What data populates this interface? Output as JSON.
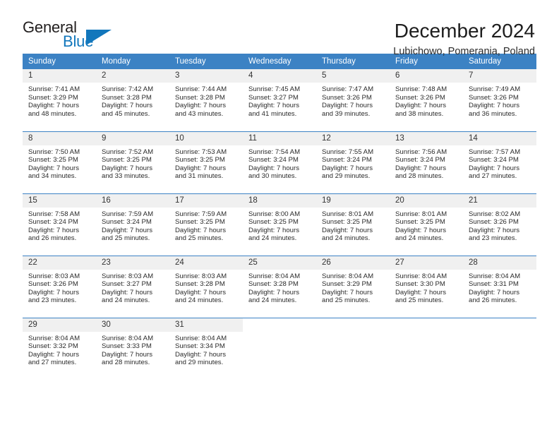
{
  "brand": {
    "name_part1": "General",
    "name_part2": "Blue",
    "logo_icon": "triangle-flag-icon",
    "accent_color": "#1277bc"
  },
  "header": {
    "title": "December 2024",
    "location": "Lubichowo, Pomerania, Poland"
  },
  "theme": {
    "header_row_bg": "#3c82c4",
    "daynum_bg": "#f0f0f0",
    "week_divider": "#3c82c4",
    "text": "#2b2b2b"
  },
  "calendar": {
    "weekday_headers": [
      "Sunday",
      "Monday",
      "Tuesday",
      "Wednesday",
      "Thursday",
      "Friday",
      "Saturday"
    ],
    "weeks": [
      [
        {
          "day": "1",
          "sunrise": "Sunrise: 7:41 AM",
          "sunset": "Sunset: 3:29 PM",
          "daylight_line1": "Daylight: 7 hours",
          "daylight_line2": "and 48 minutes."
        },
        {
          "day": "2",
          "sunrise": "Sunrise: 7:42 AM",
          "sunset": "Sunset: 3:28 PM",
          "daylight_line1": "Daylight: 7 hours",
          "daylight_line2": "and 45 minutes."
        },
        {
          "day": "3",
          "sunrise": "Sunrise: 7:44 AM",
          "sunset": "Sunset: 3:28 PM",
          "daylight_line1": "Daylight: 7 hours",
          "daylight_line2": "and 43 minutes."
        },
        {
          "day": "4",
          "sunrise": "Sunrise: 7:45 AM",
          "sunset": "Sunset: 3:27 PM",
          "daylight_line1": "Daylight: 7 hours",
          "daylight_line2": "and 41 minutes."
        },
        {
          "day": "5",
          "sunrise": "Sunrise: 7:47 AM",
          "sunset": "Sunset: 3:26 PM",
          "daylight_line1": "Daylight: 7 hours",
          "daylight_line2": "and 39 minutes."
        },
        {
          "day": "6",
          "sunrise": "Sunrise: 7:48 AM",
          "sunset": "Sunset: 3:26 PM",
          "daylight_line1": "Daylight: 7 hours",
          "daylight_line2": "and 38 minutes."
        },
        {
          "day": "7",
          "sunrise": "Sunrise: 7:49 AM",
          "sunset": "Sunset: 3:26 PM",
          "daylight_line1": "Daylight: 7 hours",
          "daylight_line2": "and 36 minutes."
        }
      ],
      [
        {
          "day": "8",
          "sunrise": "Sunrise: 7:50 AM",
          "sunset": "Sunset: 3:25 PM",
          "daylight_line1": "Daylight: 7 hours",
          "daylight_line2": "and 34 minutes."
        },
        {
          "day": "9",
          "sunrise": "Sunrise: 7:52 AM",
          "sunset": "Sunset: 3:25 PM",
          "daylight_line1": "Daylight: 7 hours",
          "daylight_line2": "and 33 minutes."
        },
        {
          "day": "10",
          "sunrise": "Sunrise: 7:53 AM",
          "sunset": "Sunset: 3:25 PM",
          "daylight_line1": "Daylight: 7 hours",
          "daylight_line2": "and 31 minutes."
        },
        {
          "day": "11",
          "sunrise": "Sunrise: 7:54 AM",
          "sunset": "Sunset: 3:24 PM",
          "daylight_line1": "Daylight: 7 hours",
          "daylight_line2": "and 30 minutes."
        },
        {
          "day": "12",
          "sunrise": "Sunrise: 7:55 AM",
          "sunset": "Sunset: 3:24 PM",
          "daylight_line1": "Daylight: 7 hours",
          "daylight_line2": "and 29 minutes."
        },
        {
          "day": "13",
          "sunrise": "Sunrise: 7:56 AM",
          "sunset": "Sunset: 3:24 PM",
          "daylight_line1": "Daylight: 7 hours",
          "daylight_line2": "and 28 minutes."
        },
        {
          "day": "14",
          "sunrise": "Sunrise: 7:57 AM",
          "sunset": "Sunset: 3:24 PM",
          "daylight_line1": "Daylight: 7 hours",
          "daylight_line2": "and 27 minutes."
        }
      ],
      [
        {
          "day": "15",
          "sunrise": "Sunrise: 7:58 AM",
          "sunset": "Sunset: 3:24 PM",
          "daylight_line1": "Daylight: 7 hours",
          "daylight_line2": "and 26 minutes."
        },
        {
          "day": "16",
          "sunrise": "Sunrise: 7:59 AM",
          "sunset": "Sunset: 3:24 PM",
          "daylight_line1": "Daylight: 7 hours",
          "daylight_line2": "and 25 minutes."
        },
        {
          "day": "17",
          "sunrise": "Sunrise: 7:59 AM",
          "sunset": "Sunset: 3:25 PM",
          "daylight_line1": "Daylight: 7 hours",
          "daylight_line2": "and 25 minutes."
        },
        {
          "day": "18",
          "sunrise": "Sunrise: 8:00 AM",
          "sunset": "Sunset: 3:25 PM",
          "daylight_line1": "Daylight: 7 hours",
          "daylight_line2": "and 24 minutes."
        },
        {
          "day": "19",
          "sunrise": "Sunrise: 8:01 AM",
          "sunset": "Sunset: 3:25 PM",
          "daylight_line1": "Daylight: 7 hours",
          "daylight_line2": "and 24 minutes."
        },
        {
          "day": "20",
          "sunrise": "Sunrise: 8:01 AM",
          "sunset": "Sunset: 3:25 PM",
          "daylight_line1": "Daylight: 7 hours",
          "daylight_line2": "and 24 minutes."
        },
        {
          "day": "21",
          "sunrise": "Sunrise: 8:02 AM",
          "sunset": "Sunset: 3:26 PM",
          "daylight_line1": "Daylight: 7 hours",
          "daylight_line2": "and 23 minutes."
        }
      ],
      [
        {
          "day": "22",
          "sunrise": "Sunrise: 8:03 AM",
          "sunset": "Sunset: 3:26 PM",
          "daylight_line1": "Daylight: 7 hours",
          "daylight_line2": "and 23 minutes."
        },
        {
          "day": "23",
          "sunrise": "Sunrise: 8:03 AM",
          "sunset": "Sunset: 3:27 PM",
          "daylight_line1": "Daylight: 7 hours",
          "daylight_line2": "and 24 minutes."
        },
        {
          "day": "24",
          "sunrise": "Sunrise: 8:03 AM",
          "sunset": "Sunset: 3:28 PM",
          "daylight_line1": "Daylight: 7 hours",
          "daylight_line2": "and 24 minutes."
        },
        {
          "day": "25",
          "sunrise": "Sunrise: 8:04 AM",
          "sunset": "Sunset: 3:28 PM",
          "daylight_line1": "Daylight: 7 hours",
          "daylight_line2": "and 24 minutes."
        },
        {
          "day": "26",
          "sunrise": "Sunrise: 8:04 AM",
          "sunset": "Sunset: 3:29 PM",
          "daylight_line1": "Daylight: 7 hours",
          "daylight_line2": "and 25 minutes."
        },
        {
          "day": "27",
          "sunrise": "Sunrise: 8:04 AM",
          "sunset": "Sunset: 3:30 PM",
          "daylight_line1": "Daylight: 7 hours",
          "daylight_line2": "and 25 minutes."
        },
        {
          "day": "28",
          "sunrise": "Sunrise: 8:04 AM",
          "sunset": "Sunset: 3:31 PM",
          "daylight_line1": "Daylight: 7 hours",
          "daylight_line2": "and 26 minutes."
        }
      ],
      [
        {
          "day": "29",
          "sunrise": "Sunrise: 8:04 AM",
          "sunset": "Sunset: 3:32 PM",
          "daylight_line1": "Daylight: 7 hours",
          "daylight_line2": "and 27 minutes."
        },
        {
          "day": "30",
          "sunrise": "Sunrise: 8:04 AM",
          "sunset": "Sunset: 3:33 PM",
          "daylight_line1": "Daylight: 7 hours",
          "daylight_line2": "and 28 minutes."
        },
        {
          "day": "31",
          "sunrise": "Sunrise: 8:04 AM",
          "sunset": "Sunset: 3:34 PM",
          "daylight_line1": "Daylight: 7 hours",
          "daylight_line2": "and 29 minutes."
        },
        {
          "day": "",
          "sunrise": "",
          "sunset": "",
          "daylight_line1": "",
          "daylight_line2": ""
        },
        {
          "day": "",
          "sunrise": "",
          "sunset": "",
          "daylight_line1": "",
          "daylight_line2": ""
        },
        {
          "day": "",
          "sunrise": "",
          "sunset": "",
          "daylight_line1": "",
          "daylight_line2": ""
        },
        {
          "day": "",
          "sunrise": "",
          "sunset": "",
          "daylight_line1": "",
          "daylight_line2": ""
        }
      ]
    ]
  }
}
